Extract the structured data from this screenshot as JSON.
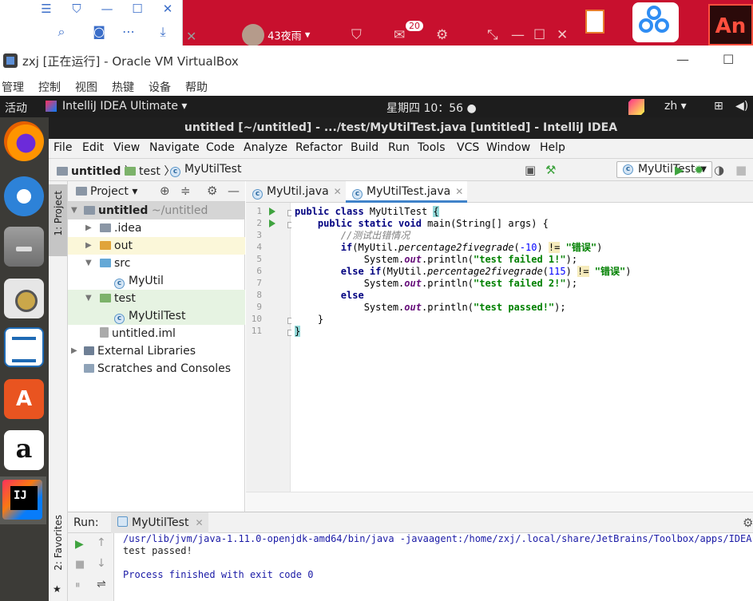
{
  "host": {
    "weather": "43夜雨",
    "mail_count": "20",
    "adobe_label": "An"
  },
  "vbox": {
    "title": "zxj [正在运行] - Oracle VM VirtualBox",
    "menu": [
      "管理",
      "控制",
      "视图",
      "热键",
      "设备",
      "帮助"
    ]
  },
  "ubuntu": {
    "activities": "活动",
    "app_name": "IntelliJ IDEA Ultimate",
    "clock": "星期四 10：56",
    "lang": "zh"
  },
  "ide": {
    "title": "untitled [~/untitled] - .../test/MyUtilTest.java [untitled] - IntelliJ IDEA",
    "menu": [
      "File",
      "Edit",
      "View",
      "Navigate",
      "Code",
      "Analyze",
      "Refactor",
      "Build",
      "Run",
      "Tools",
      "VCS",
      "Window",
      "Help"
    ],
    "breadcrumb": [
      "untitled",
      "test",
      "MyUtilTest"
    ],
    "run_config": "MyUtilTest",
    "left_stripe": [
      "1: Project",
      "2: Favorites"
    ],
    "project_panel": {
      "label": "Project",
      "tree": [
        {
          "label": "untitled",
          "suffix": "~/untitled"
        },
        {
          "label": ".idea"
        },
        {
          "label": "out"
        },
        {
          "label": "src"
        },
        {
          "label": "MyUtil"
        },
        {
          "label": "test"
        },
        {
          "label": "MyUtilTest"
        },
        {
          "label": "untitled.iml"
        },
        {
          "label": "External Libraries"
        },
        {
          "label": "Scratches and Consoles"
        }
      ]
    },
    "tabs": [
      "MyUtil.java",
      "MyUtilTest.java"
    ],
    "line_numbers": [
      "1",
      "2",
      "3",
      "4",
      "5",
      "6",
      "7",
      "8",
      "9",
      "10",
      "11"
    ],
    "code": {
      "l1_kw": "public class",
      "l1_name": " MyUtilTest ",
      "l1_brace": "{",
      "l2_kw": "public static void",
      "l2_rest": " main(String[] args) {",
      "l3_comment": "//测试出错情况",
      "l4_kw": "if",
      "l4_a": "(MyUtil.",
      "l4_m": "percentage2fivegrade",
      "l4_b": "(",
      "l4_n": "-10",
      "l4_c": ") ",
      "l4_op": "!=",
      "l4_s": "\"错误\"",
      "l4_d": ")",
      "l5_a": "System.",
      "l5_f": "out",
      "l5_b": ".println(",
      "l5_s": "\"test failed 1!\"",
      "l5_c": ");",
      "l6_kw": "else if",
      "l6_a": "(MyUtil.",
      "l6_m": "percentage2fivegrade",
      "l6_b": "(",
      "l6_n": "115",
      "l6_c": ") ",
      "l6_op": "!=",
      "l6_s": "\"错误\"",
      "l6_d": ")",
      "l7_a": "System.",
      "l7_f": "out",
      "l7_b": ".println(",
      "l7_s": "\"test failed 2!\"",
      "l7_c": ");",
      "l8_kw": "else",
      "l9_a": "System.",
      "l9_f": "out",
      "l9_b": ".println(",
      "l9_s": "\"test passed!\"",
      "l9_c": ");",
      "l10": "}",
      "l11": "}"
    },
    "run": {
      "label": "Run:",
      "tab": "MyUtilTest",
      "output": [
        "/usr/lib/jvm/java-1.11.0-openjdk-amd64/bin/java -javaagent:/home/zxj/.local/share/JetBrains/Toolbox/apps/IDEA-U/c",
        "test passed!",
        "",
        "Process finished with exit code 0"
      ]
    }
  }
}
